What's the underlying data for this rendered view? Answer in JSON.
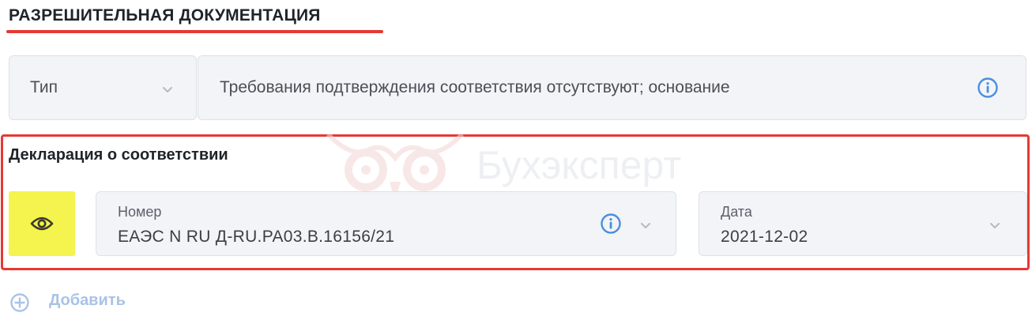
{
  "section": {
    "title": "РАЗРЕШИТЕЛЬНАЯ ДОКУМЕНТАЦИЯ"
  },
  "type_row": {
    "select_label": "Тип",
    "value": "Требования подтверждения соответствия отсутствуют; основание"
  },
  "declaration": {
    "title": "Декларация о соответствии",
    "watermark": "Бухэксперт",
    "number_label": "Номер",
    "number_value": "ЕАЭС N RU Д-RU.PA03.B.16156/21",
    "date_label": "Дата",
    "date_value": "2021-12-02"
  },
  "add": {
    "label": "Добавить"
  },
  "colors": {
    "accent_red": "#e53935",
    "eye_button_bg": "#f5f34d",
    "info_blue": "#4a8fe0",
    "add_blue": "#a9c3e6"
  },
  "icons": [
    "chevron-down-icon",
    "info-icon",
    "eye-icon",
    "plus-circle-icon"
  ]
}
